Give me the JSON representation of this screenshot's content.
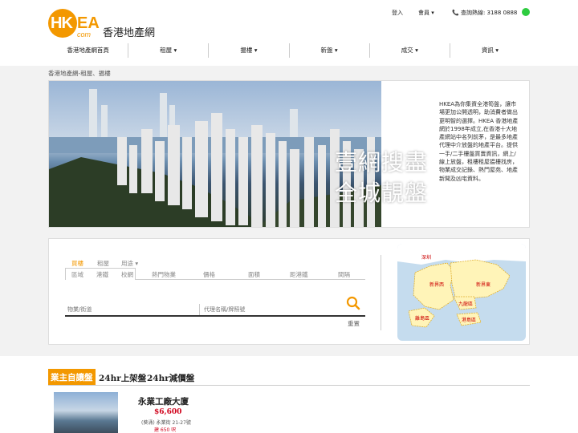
{
  "header": {
    "logo_hk": "HK",
    "logo_ea": "EA",
    "logo_com": "com",
    "site_name": "香港地產網",
    "login": "登入",
    "member": "會員 ▾",
    "phone": "📞 查詢熱線: 3188 0888"
  },
  "nav": {
    "items": [
      "香港地產網首頁",
      "租屋 ▾",
      "揾樓 ▾",
      "新盤 ▾",
      "成交 ▾",
      "資訊 ▾"
    ]
  },
  "breadcrumb": "香港地產網-租屋、揾樓",
  "hero": {
    "slogan_line1": "壹網搜盡",
    "slogan_line2": "全城靚盤",
    "description": "HKEA為你集資全港筍盤，讓市場更加公開透明，助消費者做出更明智的選擇。HKEA 香港地產網於1998年成立,在香港十大地產網站中名列前茅，是最多地產代理中介放盤的地產平台。提供一手/二手樓盤買賣資訊，網上/線上放盤，租樓租屋揾樓找房，物業成交記錄、熱門屋苑、地產新聞及凶宅資料。"
  },
  "search": {
    "tabs": [
      "買樓",
      "租屋",
      "用途 ▾"
    ],
    "filter_tabs": [
      "區域",
      "港鐵",
      "校網",
      "熱門物業",
      "價格",
      "面積",
      "距港鐵",
      "間隔"
    ],
    "input1_placeholder": "物業/街道",
    "input2_placeholder": "代理名稱/牌照號",
    "reset_label": "重置"
  },
  "map": {
    "labels": [
      "深圳",
      "新界西",
      "新界東",
      "九龍區",
      "離島區",
      "港島區"
    ]
  },
  "listings": {
    "tabs": [
      "業主自讓盤",
      "24hr上架盤",
      "24hr減價盤"
    ],
    "items": [
      {
        "title": "永業工廠大廈",
        "price": "$6,600",
        "address": "(葵涌) 永業街 21-27號",
        "area": "建 650 呎"
      }
    ]
  },
  "colors": {
    "brand": "#f39800",
    "price": "#d0021b",
    "whatsapp": "#2ecc40"
  }
}
